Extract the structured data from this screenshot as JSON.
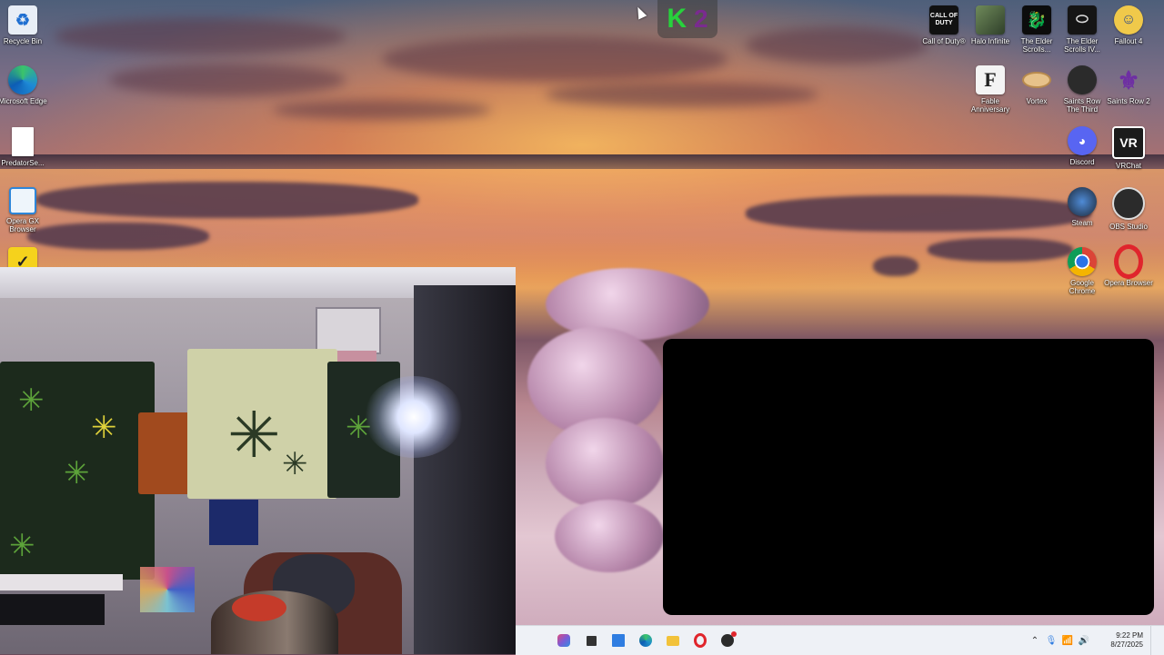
{
  "desktop": {
    "left_icons": [
      {
        "name": "recycle-bin-icon",
        "label": "Recycle Bin"
      },
      {
        "name": "microsoft-edge-icon",
        "label": "Microsoft Edge"
      },
      {
        "name": "predator-file-icon",
        "label": "PredatorSe..."
      },
      {
        "name": "opera-gx-icon",
        "label": "Opera GX Browser"
      },
      {
        "name": "norton-check-icon",
        "label": ""
      }
    ],
    "right_icons": [
      {
        "name": "call-of-duty-icon",
        "label": "Call of Duty®",
        "glyph": "CALL OF DUTY"
      },
      {
        "name": "halo-infinite-icon",
        "label": "Halo Infinite",
        "glyph": ""
      },
      {
        "name": "elder-scrolls-icon",
        "label": "The Elder Scrolls...",
        "glyph": ""
      },
      {
        "name": "elder-scrolls-iv-icon",
        "label": "The Elder Scrolls IV...",
        "glyph": ""
      },
      {
        "name": "fallout4-icon",
        "label": "Fallout 4",
        "glyph": ""
      },
      {
        "name": "fable-anniversary-icon",
        "label": "Fable Anniversary",
        "glyph": "F"
      },
      {
        "name": "vortex-icon",
        "label": "Vortex",
        "glyph": ""
      },
      {
        "name": "saints-row-third-icon",
        "label": "Saints Row The Third",
        "glyph": ""
      },
      {
        "name": "saints-row-2-icon",
        "label": "Saints Row 2",
        "glyph": "⚜"
      },
      {
        "name": "discord-icon",
        "label": "Discord",
        "glyph": ""
      },
      {
        "name": "vrchat-icon",
        "label": "VRChat",
        "glyph": "VR"
      },
      {
        "name": "steam-icon",
        "label": "Steam",
        "glyph": ""
      },
      {
        "name": "obs-studio-icon",
        "label": "OBS Studio",
        "glyph": ""
      },
      {
        "name": "google-chrome-icon",
        "label": "Google Chrome",
        "glyph": ""
      },
      {
        "name": "opera-browser-icon",
        "label": "Opera Browser",
        "glyph": ""
      }
    ]
  },
  "widget": {
    "letter": "K",
    "number": "2"
  },
  "taskbar": {
    "apps": [
      {
        "name": "copilot-icon",
        "color": "#7b5bd6"
      },
      {
        "name": "task-view-icon",
        "color": "#333333"
      },
      {
        "name": "store-icon",
        "color": "#2f7de1"
      },
      {
        "name": "edge-taskbar-icon",
        "color": "#1e90c8"
      },
      {
        "name": "file-explorer-icon",
        "color": "#f2c23a"
      },
      {
        "name": "opera-taskbar-icon",
        "color": "#e0252c"
      },
      {
        "name": "obs-taskbar-icon",
        "color": "#2b2b2b"
      }
    ],
    "clock": {
      "time": "9:22 PM",
      "date": "8/27/2025"
    }
  },
  "colors": {
    "taskbar_bg": "#eef1f6",
    "overlay": "#000000"
  }
}
